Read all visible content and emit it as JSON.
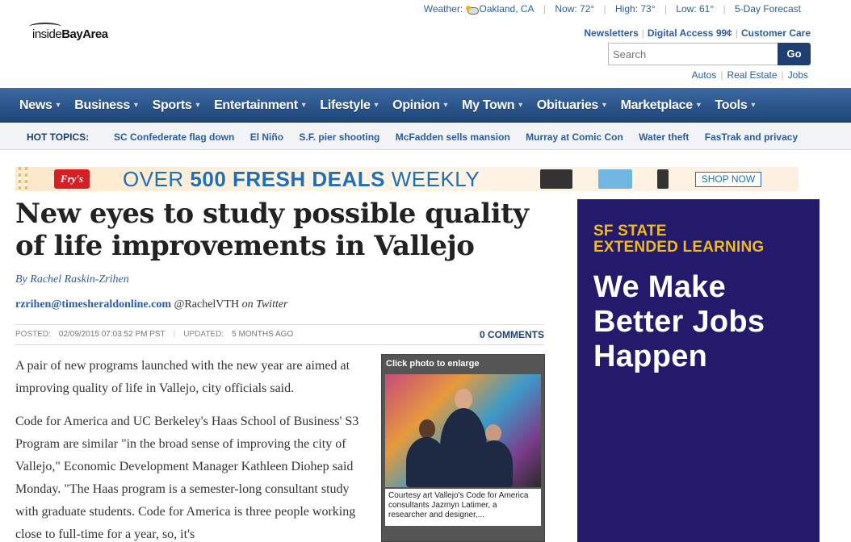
{
  "header": {
    "logo_prefix": "inside",
    "logo_suffix": "BayArea",
    "weather": {
      "label": "Weather:",
      "location": "Oakland, CA",
      "now": "Now: 72°",
      "high": "High: 73°",
      "low": "Low: 61°",
      "forecast": "5-Day Forecast"
    },
    "account_links": [
      "Newsletters",
      "Digital Access 99¢",
      "Customer Care"
    ],
    "search": {
      "placeholder": "Search",
      "button": "Go"
    },
    "sub_links": [
      "Autos",
      "Real Estate",
      "Jobs"
    ]
  },
  "nav": {
    "items": [
      "News",
      "Business",
      "Sports",
      "Entertainment",
      "Lifestyle",
      "Opinion",
      "My Town",
      "Obituaries",
      "Marketplace",
      "Tools"
    ]
  },
  "hot_topics": {
    "label": "HOT TOPICS:",
    "items": [
      "SC Confederate flag down",
      "El Niño",
      "S.F. pier shooting",
      "McFadden sells mansion",
      "Murray at Comic Con",
      "Water theft",
      "FasTrak and privacy"
    ]
  },
  "banner": {
    "brand": "Fry's",
    "brand_small": "ELECTRONICS",
    "text_pre": "OVER ",
    "text_bold": "500 FRESH DEALS",
    "text_post": " WEEKLY",
    "cta": "SHOP NOW"
  },
  "article": {
    "headline": "New eyes to study possible quality of life improvements in Vallejo",
    "byline": "By Rachel Raskin-Zrihen",
    "email": "rzrihen@timesheraldonline.com",
    "twitter_handle": "@RachelVTH",
    "twitter_suffix": "on Twitter",
    "posted_label": "POSTED:",
    "posted_value": "02/09/2015 07:03:52 PM PST",
    "updated_label": "UPDATED:",
    "updated_value": "5 MONTHS AGO",
    "comments": "0 COMMENTS",
    "paragraphs": [
      "A pair of new programs launched with the new year are aimed at improving quality of life in Vallejo, city officials said.",
      "Code for America and UC Berkeley's Haas School of Business' S3 Program are similar \"in the broad sense of improving the city of Vallejo,\" Economic Development Manager Kathleen Diohep said Monday. \"The Haas program is a semester-long consultant study with graduate students. Code for America is three people working close to full-time for a year, so, it's"
    ]
  },
  "photo": {
    "header": "Click photo to enlarge",
    "caption": "Courtesy art Vallejo's Code for America consultants Jazmyn Latimer, a researcher and designer,..."
  },
  "side_ad": {
    "line1": "SF STATE",
    "line2": "EXTENDED LEARNING",
    "headline": "We Make Better Jobs Happen"
  }
}
